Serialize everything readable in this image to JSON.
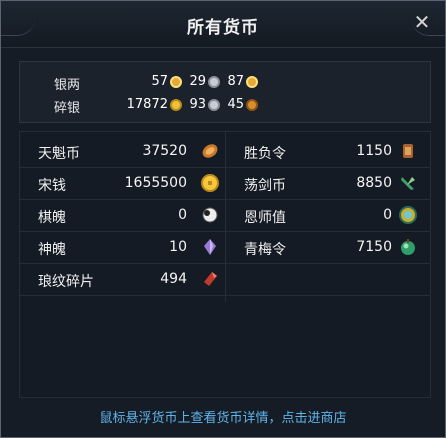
{
  "window": {
    "title": "所有货币",
    "close_icon": "close-icon"
  },
  "silver": [
    {
      "label": "银两",
      "gold": "57",
      "silver": "29",
      "copper": "87"
    },
    {
      "label": "碎银",
      "gold": "17872",
      "silver": "93",
      "copper": "45"
    }
  ],
  "currencies": [
    {
      "name": "天魁币",
      "value": "37520",
      "icon": "scroll-coin-icon"
    },
    {
      "name": "胜负令",
      "value": "1150",
      "icon": "token-icon"
    },
    {
      "name": "宋钱",
      "value": "1655500",
      "icon": "gold-coin-icon"
    },
    {
      "name": "荡剑币",
      "value": "8850",
      "icon": "jade-sword-icon"
    },
    {
      "name": "棋魄",
      "value": "0",
      "icon": "go-stone-icon"
    },
    {
      "name": "恩师值",
      "value": "0",
      "icon": "medal-icon"
    },
    {
      "name": "神魄",
      "value": "10",
      "icon": "purple-crystal-icon"
    },
    {
      "name": "青梅令",
      "value": "7150",
      "icon": "green-plum-icon"
    },
    {
      "name": "琅纹碎片",
      "value": "494",
      "icon": "red-shard-icon"
    }
  ],
  "footer": {
    "hint": "鼠标悬浮货币上查看货币详情，点击进商店"
  },
  "colors": {
    "accent_link": "#5fb4ea",
    "panel": "#161c25"
  }
}
